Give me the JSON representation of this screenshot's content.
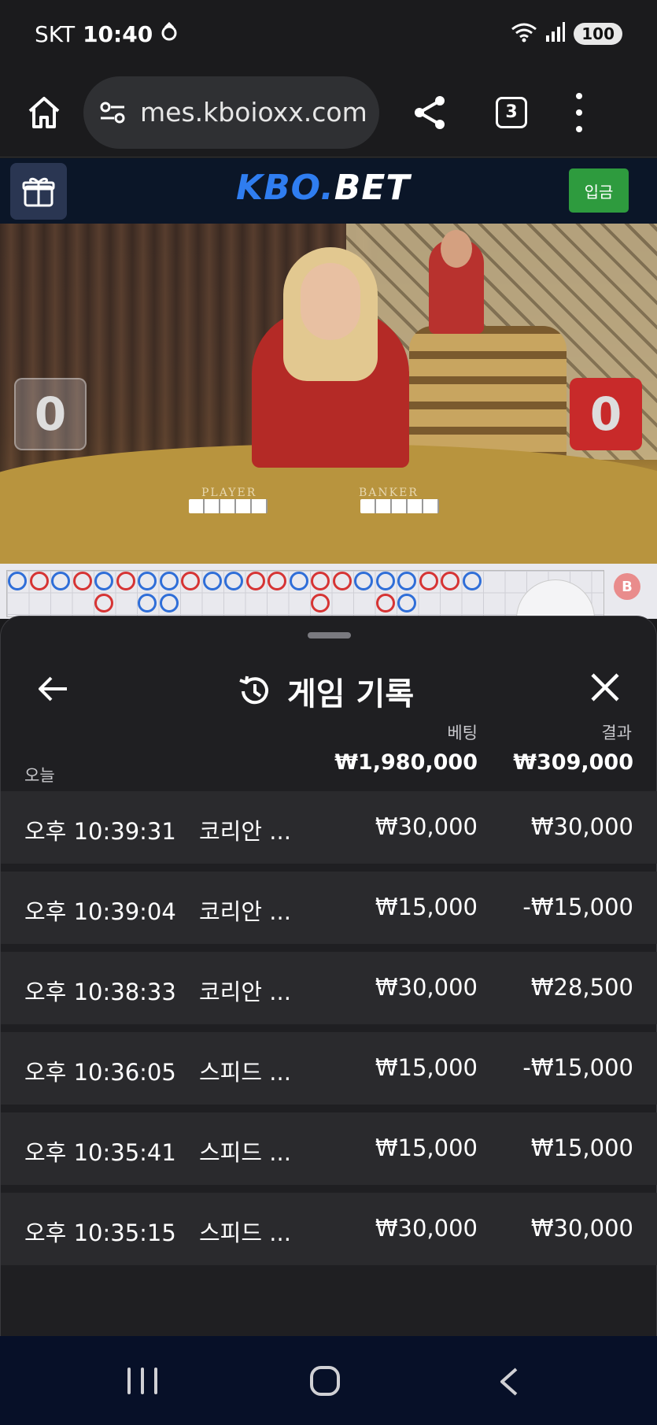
{
  "status_bar": {
    "carrier": "SKT",
    "time": "10:40",
    "battery": "100"
  },
  "browser": {
    "url": "mes.kboioxx.com",
    "tab_count": "3"
  },
  "site_header": {
    "logo_part1": "KBO.",
    "logo_part2": "BET",
    "deposit_label": "입금",
    "brand_color": "#2f7df0",
    "deposit_color": "#2e9b3e"
  },
  "live_game": {
    "player_score": "0",
    "banker_score": "0",
    "player_label": "PLAYER",
    "banker_label": "BANKER",
    "banker_chip": "B"
  },
  "history_sheet": {
    "title": "게임 기록",
    "column_bet": "베팅",
    "column_result": "결과",
    "today_label": "오늘",
    "total_bet": "₩1,980,000",
    "total_result": "₩309,000",
    "rows": [
      {
        "time": "오후 10:39:31",
        "game": "코리안 ...",
        "bet": "₩30,000",
        "result": "₩30,000"
      },
      {
        "time": "오후 10:39:04",
        "game": "코리안 ...",
        "bet": "₩15,000",
        "result": "-₩15,000"
      },
      {
        "time": "오후 10:38:33",
        "game": "코리안 ...",
        "bet": "₩30,000",
        "result": "₩28,500"
      },
      {
        "time": "오후 10:36:05",
        "game": "스피드 ...",
        "bet": "₩15,000",
        "result": "-₩15,000"
      },
      {
        "time": "오후 10:35:41",
        "game": "스피드 ...",
        "bet": "₩15,000",
        "result": "₩15,000"
      },
      {
        "time": "오후 10:35:15",
        "game": "스피드 ...",
        "bet": "₩30,000",
        "result": "₩30,000"
      }
    ]
  }
}
